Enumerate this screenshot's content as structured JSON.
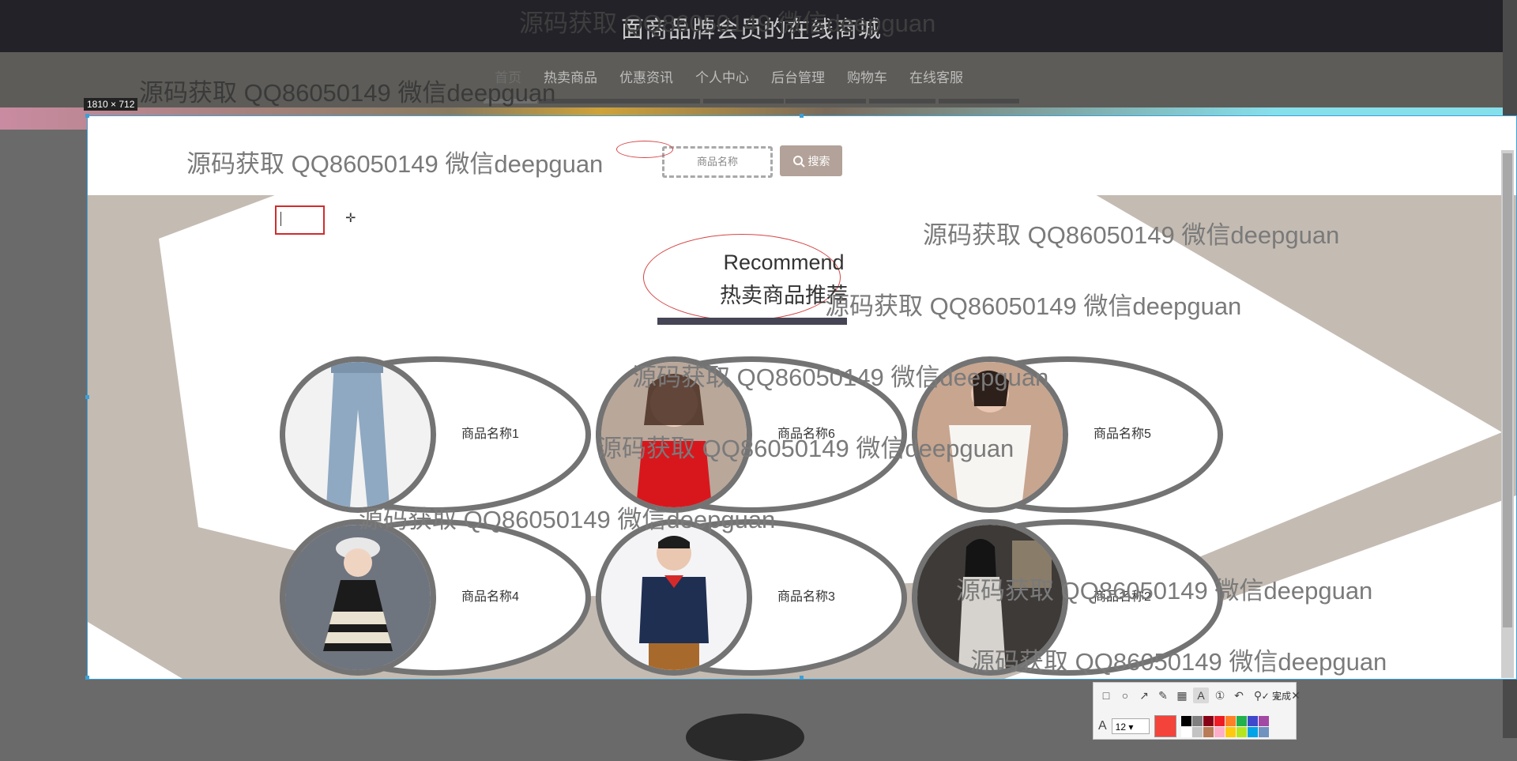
{
  "site": {
    "title": "面商品牌会员的在线商城",
    "nav": [
      "首页",
      "热卖商品",
      "优惠资讯",
      "个人中心",
      "后台管理",
      "购物车",
      "在线客服"
    ],
    "nav_active_index": 0
  },
  "capture": {
    "size_label": "1810 × 712"
  },
  "search": {
    "placeholder": "商品名称",
    "button_label": "搜索"
  },
  "recommend": {
    "title_en": "Recommend",
    "title_cn": "热卖商品推荐"
  },
  "products": [
    {
      "name": "商品名称1",
      "image": "jeans-photo"
    },
    {
      "name": "商品名称6",
      "image": "red-top-photo"
    },
    {
      "name": "商品名称5",
      "image": "white-tee-photo"
    },
    {
      "name": "商品名称4",
      "image": "girl-dress-photo"
    },
    {
      "name": "商品名称3",
      "image": "boy-polo-photo"
    },
    {
      "name": "商品名称2",
      "image": "woman-coat-photo"
    }
  ],
  "watermark_text": "源码获取 QQ86050149 微信deepguan",
  "toolbar": {
    "done_label": "完成",
    "font_size": "12",
    "current_color": "#f4433b",
    "palette": [
      "#000000",
      "#7f7f7f",
      "#880015",
      "#ed1c24",
      "#ff7f27",
      "#22b14c",
      "#3f48cc",
      "#a349a4",
      "#ffffff",
      "#c3c3c3",
      "#b97a57",
      "#ffaec9",
      "#ffc90e",
      "#b5e61d",
      "#00a2e8",
      "#7092be"
    ]
  }
}
